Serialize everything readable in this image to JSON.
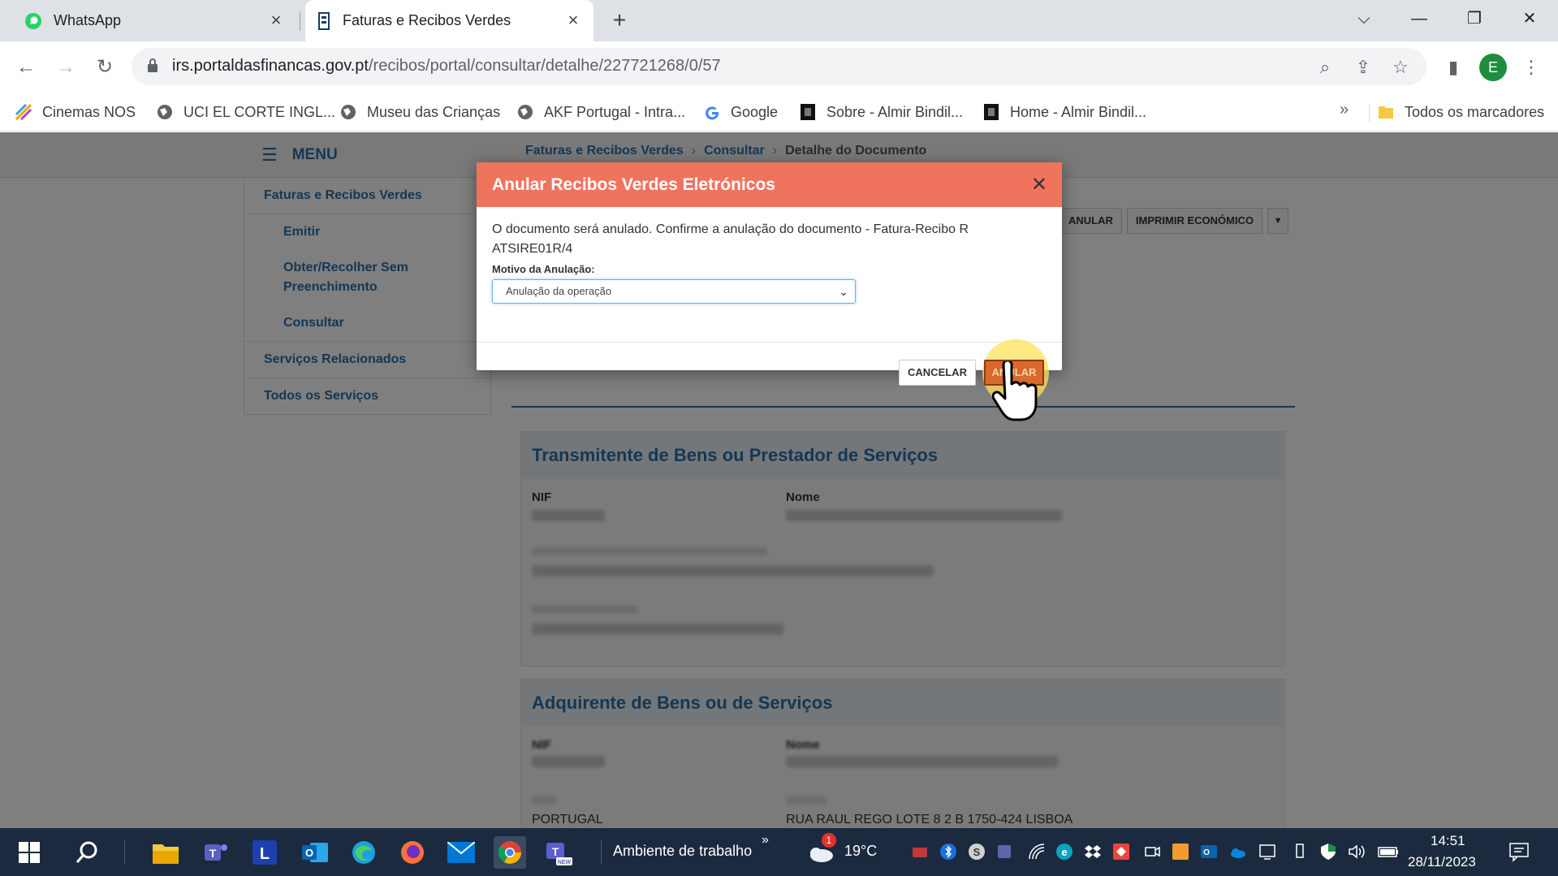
{
  "browser": {
    "tabs": [
      {
        "label": "WhatsApp",
        "icon": "whatsapp-icon"
      },
      {
        "label": "Faturas e Recibos Verdes",
        "icon": "portal-icon"
      }
    ],
    "url_host": "irs.portaldasfinancas.gov.pt",
    "url_path": "/recibos/portal/consultar/detalhe/227721268/0/57",
    "profile_initial": "E",
    "bookmarks": [
      "Cinemas NOS",
      "UCI EL CORTE INGL...",
      "Museu das Crianças",
      "AKF Portugal - Intra...",
      "Google",
      "Sobre - Almir Bindil...",
      "Home - Almir Bindil..."
    ],
    "bookmarks_more": "»",
    "all_bookmarks": "Todos os marcadores"
  },
  "page": {
    "menu_label": "MENU",
    "breadcrumb": [
      "Faturas e Recibos Verdes",
      "Consultar",
      "Detalhe do Documento"
    ],
    "sidebar": [
      {
        "label": "Faturas e Recibos Verdes",
        "sub": false
      },
      {
        "label": "Emitir",
        "sub": true
      },
      {
        "label": "Obter/Recolher Sem Preenchimento",
        "sub": true
      },
      {
        "label": "Consultar",
        "sub": true
      },
      {
        "label": "Serviços Relacionados",
        "sub": false
      },
      {
        "label": "Todos os Serviços",
        "sub": false
      }
    ],
    "actions": {
      "anular": "ANULAR",
      "imprimir": "IMPRIMIR ECONÓMICO"
    },
    "section1": {
      "title": "Transmitente de Bens ou Prestador de Serviços",
      "nif_label": "NIF",
      "nome_label": "Nome"
    },
    "section2": {
      "title": "Adquirente de Bens ou de Serviços",
      "nif_label": "NIF",
      "nome_label": "Nome",
      "country": "PORTUGAL",
      "address": "RUA RAUL REGO LOTE 8 2 B 1750-424 LISBOA"
    }
  },
  "modal": {
    "title": "Anular Recibos Verdes Eletrónicos",
    "message": "O documento será anulado. Confirme a anulação do documento - Fatura-Recibo R ATSIRE01R/4",
    "field_label": "Motivo da Anulação:",
    "selected_reason": "Anulação da operação",
    "cancel_label": "CANCELAR",
    "confirm_label": "ANULAR"
  },
  "taskbar": {
    "search_label": "Ambiente de trabalho",
    "weather": "19°C",
    "weather_badge": "1",
    "time": "14:51",
    "date": "28/11/2023"
  },
  "colors": {
    "modal_header": "#f0735e",
    "link_blue": "#2b6fa8",
    "confirm_button": "#d9692d"
  }
}
